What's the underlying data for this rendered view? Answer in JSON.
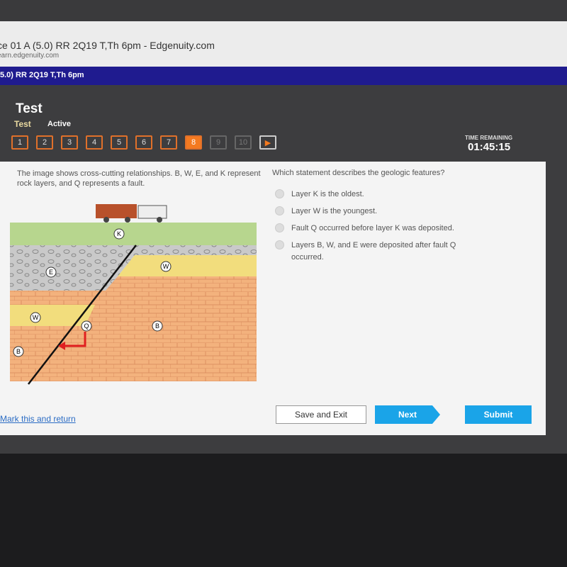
{
  "browser": {
    "title": "ce 01 A (5.0) RR 2Q19 T,Th 6pm - Edgenuity.com",
    "url": "earn.edgenuity.com"
  },
  "course_bar": {
    "title": "5.0) RR 2Q19 T,Th 6pm"
  },
  "header": {
    "title": "Test",
    "tabs": [
      "Test",
      "Active"
    ]
  },
  "question_nav": {
    "items": [
      "1",
      "2",
      "3",
      "4",
      "5",
      "6",
      "7",
      "8",
      "9",
      "10"
    ],
    "current": "8",
    "next_icon": "play-icon"
  },
  "timer": {
    "label": "TIME REMAINING",
    "value": "01:45:15"
  },
  "question": {
    "prompt": "The image shows cross-cutting relationships. B, W, E, and K represent rock layers, and Q represents a fault.",
    "text": "Which statement describes the geologic features?",
    "options": [
      "Layer K is the oldest.",
      "Layer W is the youngest.",
      "Fault Q occurred before layer K was deposited.",
      "Layers B, W, and E were deposited after fault Q occurred."
    ]
  },
  "diagram": {
    "labels": {
      "k": "K",
      "e": "E",
      "w1": "W",
      "w2": "W",
      "q": "Q",
      "b1": "B",
      "b2": "B"
    }
  },
  "footer": {
    "mark": "Mark this and return",
    "save": "Save and Exit",
    "next": "Next",
    "submit": "Submit"
  },
  "colors": {
    "accent": "#f47a20",
    "button": "#1aa4e8",
    "course_bar": "#1f1b8f"
  }
}
